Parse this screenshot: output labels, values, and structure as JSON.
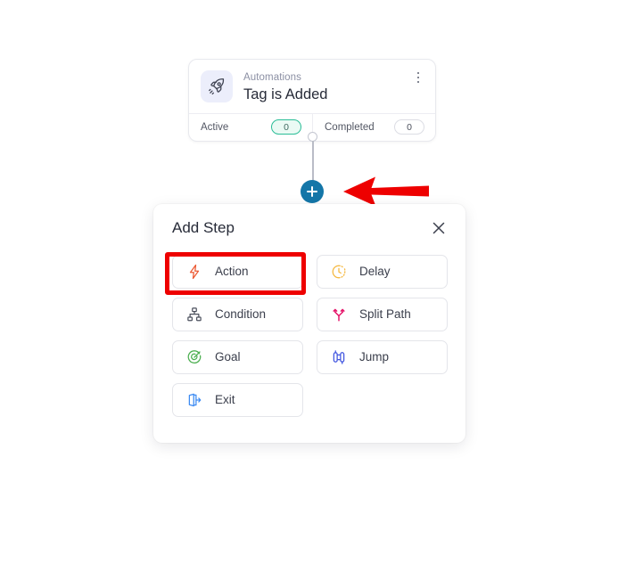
{
  "trigger_card": {
    "icon": "rocket-icon",
    "eyebrow": "Automations",
    "title": "Tag is Added",
    "menu_icon": "kebab-menu-icon",
    "stats": [
      {
        "label": "Active",
        "value": "0",
        "accent": "#2bbd97"
      },
      {
        "label": "Completed",
        "value": "0",
        "accent": "#dcdde4"
      }
    ]
  },
  "canvas": {
    "add_step_button_icon": "plus-icon",
    "add_step_button_color": "#1476a8",
    "connector_color": "#b9bcc6"
  },
  "annotations": {
    "arrow": {
      "type": "left-arrow",
      "color": "#ee0000"
    },
    "highlight": {
      "target": "Action",
      "color": "#ee0000"
    }
  },
  "add_step_panel": {
    "title": "Add Step",
    "close_icon": "close-icon",
    "options": [
      {
        "label": "Action",
        "icon": "lightning-bolt-icon",
        "color": "#ec5b35"
      },
      {
        "label": "Delay",
        "icon": "clock-dashed-icon",
        "color": "#f5b942"
      },
      {
        "label": "Condition",
        "icon": "hierarchy-icon",
        "color": "#4a4f5c"
      },
      {
        "label": "Split Path",
        "icon": "split-path-icon",
        "color": "#e5176b"
      },
      {
        "label": "Goal",
        "icon": "target-goal-icon",
        "color": "#4caf50"
      },
      {
        "label": "Jump",
        "icon": "jump-icon",
        "color": "#4458e0"
      },
      {
        "label": "Exit",
        "icon": "exit-door-icon",
        "color": "#3d8bf2"
      }
    ]
  }
}
